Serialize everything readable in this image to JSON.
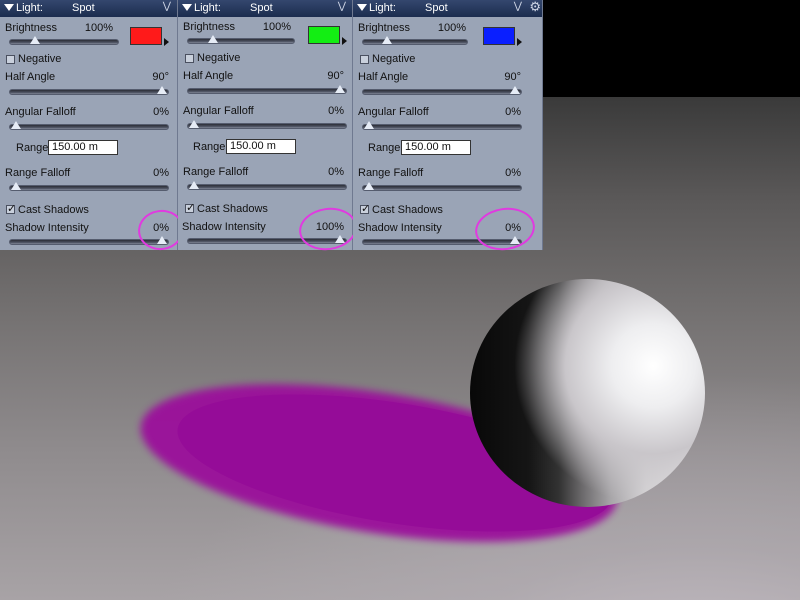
{
  "colors": {
    "panel_bg": "#9aa4b6",
    "titlebar": "#1b2c4e",
    "annotation": "#e03ae0",
    "shadow": "#950c98"
  },
  "icons": {
    "collapse": "triangle-down-icon",
    "menu": "chevron-down-icon",
    "settings": "gear-icon"
  },
  "panels": [
    {
      "title_label": "Light:",
      "title_value": "Spot",
      "brightness": {
        "label": "Brightness",
        "value": "100%",
        "level": 0.2
      },
      "color": "#ff1a1a",
      "negative": {
        "label": "Negative",
        "checked": false
      },
      "half_angle": {
        "label": "Half Angle",
        "value": "90°",
        "level": 1.0
      },
      "angular_falloff": {
        "label": "Angular Falloff",
        "value": "0%",
        "level": 0.0
      },
      "range": {
        "label": "Range",
        "value": "150.00 m"
      },
      "range_falloff": {
        "label": "Range Falloff",
        "value": "0%",
        "level": 0.0
      },
      "cast_shadows": {
        "label": "Cast Shadows",
        "checked": true
      },
      "shadow_intensity": {
        "label": "Shadow Intensity",
        "value": "0%",
        "level": 1.0
      }
    },
    {
      "title_label": "Light:",
      "title_value": "Spot",
      "brightness": {
        "label": "Brightness",
        "value": "100%",
        "level": 0.2
      },
      "color": "#13ee13",
      "negative": {
        "label": "Negative",
        "checked": false
      },
      "half_angle": {
        "label": "Half Angle",
        "value": "90°",
        "level": 1.0
      },
      "angular_falloff": {
        "label": "Angular Falloff",
        "value": "0%",
        "level": 0.0
      },
      "range": {
        "label": "Range",
        "value": "150.00 m"
      },
      "range_falloff": {
        "label": "Range Falloff",
        "value": "0%",
        "level": 0.0
      },
      "cast_shadows": {
        "label": "Cast Shadows",
        "checked": true
      },
      "shadow_intensity": {
        "label": "Shadow Intensity",
        "value": "100%",
        "level": 1.0
      }
    },
    {
      "title_label": "Light:",
      "title_value": "Spot",
      "brightness": {
        "label": "Brightness",
        "value": "100%",
        "level": 0.2
      },
      "color": "#0a1fff",
      "negative": {
        "label": "Negative",
        "checked": false
      },
      "half_angle": {
        "label": "Half Angle",
        "value": "90°",
        "level": 1.0
      },
      "angular_falloff": {
        "label": "Angular Falloff",
        "value": "0%",
        "level": 0.0
      },
      "range": {
        "label": "Range",
        "value": "150.00 m"
      },
      "range_falloff": {
        "label": "Range Falloff",
        "value": "0%",
        "level": 0.0
      },
      "cast_shadows": {
        "label": "Cast Shadows",
        "checked": true
      },
      "shadow_intensity": {
        "label": "Shadow Intensity",
        "value": "0%",
        "level": 1.0
      }
    }
  ]
}
